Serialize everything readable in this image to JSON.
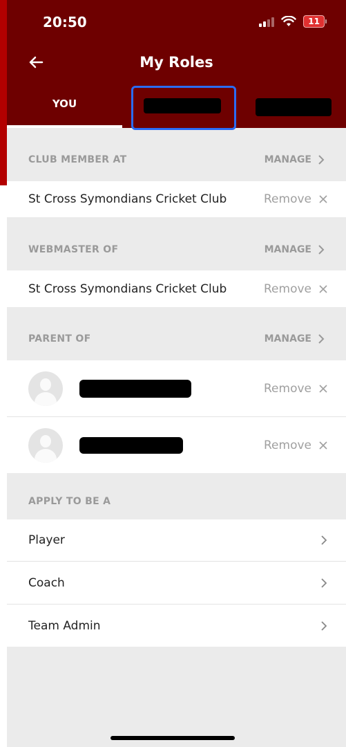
{
  "status": {
    "time": "20:50",
    "battery": "11"
  },
  "header": {
    "title": "My Roles"
  },
  "tabs": [
    {
      "label": "YOU"
    }
  ],
  "sections": {
    "club_member": {
      "title": "CLUB MEMBER AT",
      "manage": "MANAGE",
      "item": "St Cross Symondians Cricket Club",
      "remove": "Remove"
    },
    "webmaster": {
      "title": "WEBMASTER OF",
      "manage": "MANAGE",
      "item": "St Cross Symondians Cricket Club",
      "remove": "Remove"
    },
    "parent": {
      "title": "PARENT OF",
      "manage": "MANAGE",
      "remove": "Remove"
    },
    "apply": {
      "title": "APPLY TO BE A",
      "items": [
        "Player",
        "Coach",
        "Team Admin"
      ]
    }
  },
  "colors": {
    "header": "#6e0000",
    "annotation": "#2a6cf6",
    "background": "#ebebeb"
  }
}
